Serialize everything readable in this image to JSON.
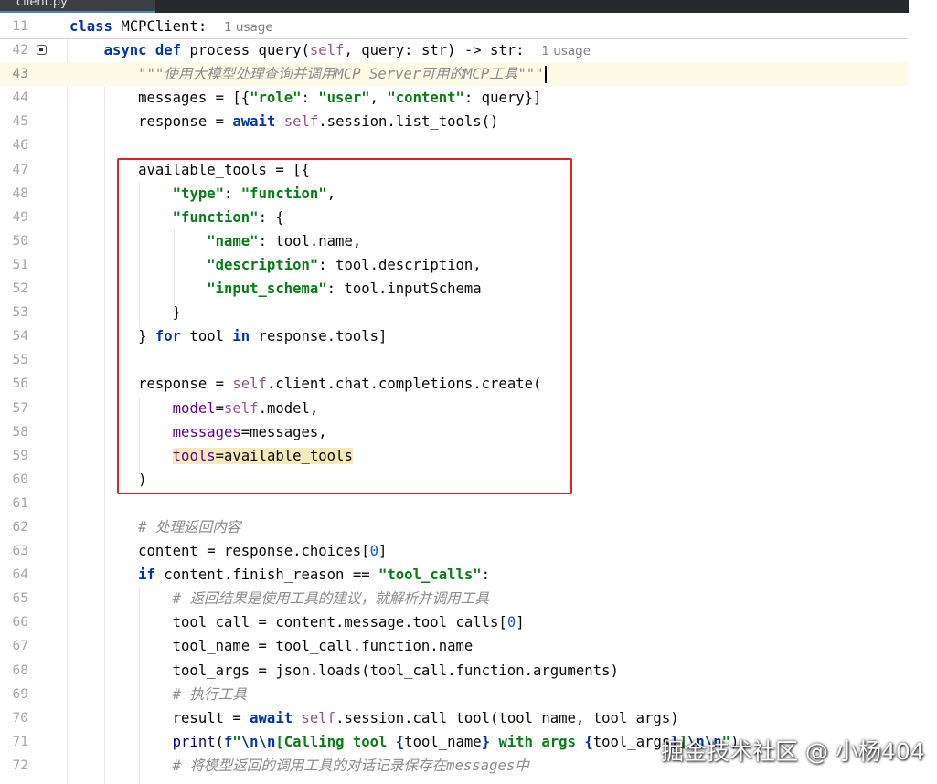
{
  "window": {
    "tab_label": "client.py"
  },
  "class_header": {
    "line_no": "11",
    "code": "class MCPClient:",
    "usage_hint": "1 usage"
  },
  "lines": [
    {
      "no": "42",
      "code": "async def process_query(self, query: str) -> str:",
      "hint": "1 usage"
    },
    {
      "no": "43",
      "code": "\"\"\"使用大模型处理查询并调用MCP Server可用的MCP工具\"\"\""
    },
    {
      "no": "44",
      "code": "messages = [{\"role\": \"user\", \"content\": query}]"
    },
    {
      "no": "45",
      "code": "response = await self.session.list_tools()"
    },
    {
      "no": "46",
      "code": ""
    },
    {
      "no": "47",
      "code": "available_tools = [{"
    },
    {
      "no": "48",
      "code": "\"type\": \"function\","
    },
    {
      "no": "49",
      "code": "\"function\": {"
    },
    {
      "no": "50",
      "code": "\"name\": tool.name,"
    },
    {
      "no": "51",
      "code": "\"description\": tool.description,"
    },
    {
      "no": "52",
      "code": "\"input_schema\": tool.inputSchema"
    },
    {
      "no": "53",
      "code": "}"
    },
    {
      "no": "54",
      "code": "} for tool in response.tools]"
    },
    {
      "no": "55",
      "code": ""
    },
    {
      "no": "56",
      "code": "response = self.client.chat.completions.create("
    },
    {
      "no": "57",
      "code": "model=self.model,"
    },
    {
      "no": "58",
      "code": "messages=messages,"
    },
    {
      "no": "59",
      "code": "tools=available_tools"
    },
    {
      "no": "60",
      "code": ")"
    },
    {
      "no": "61",
      "code": ""
    },
    {
      "no": "62",
      "code": "# 处理返回内容"
    },
    {
      "no": "63",
      "code": "content = response.choices[0]"
    },
    {
      "no": "64",
      "code": "if content.finish_reason == \"tool_calls\":"
    },
    {
      "no": "65",
      "code": "# 返回结果是使用工具的建议，就解析并调用工具"
    },
    {
      "no": "66",
      "code": "tool_call = content.message.tool_calls[0]"
    },
    {
      "no": "67",
      "code": "tool_name = tool_call.function.name"
    },
    {
      "no": "68",
      "code": "tool_args = json.loads(tool_call.function.arguments)"
    },
    {
      "no": "69",
      "code": "# 执行工具"
    },
    {
      "no": "70",
      "code": "result = await self.session.call_tool(tool_name, tool_args)"
    },
    {
      "no": "71",
      "code": "print(f\"\\n\\n[Calling tool {tool_name} with args {tool_args}]\\n\\n\")"
    },
    {
      "no": "72",
      "code": "# 将模型返回的调用工具的对话记录保存在messages中"
    }
  ],
  "watermark": "掘金技术社区 @ 小杨404",
  "colors": {
    "keyword": "#0033b3",
    "string": "#067d17",
    "self": "#94558d",
    "comment": "#8c8c8c",
    "number": "#1750eb",
    "param": "#660099",
    "highlight_box": "#e0202a",
    "current_line": "#fdfbe6"
  },
  "icons": {
    "gutter_marker": "implementation-marker-icon"
  }
}
